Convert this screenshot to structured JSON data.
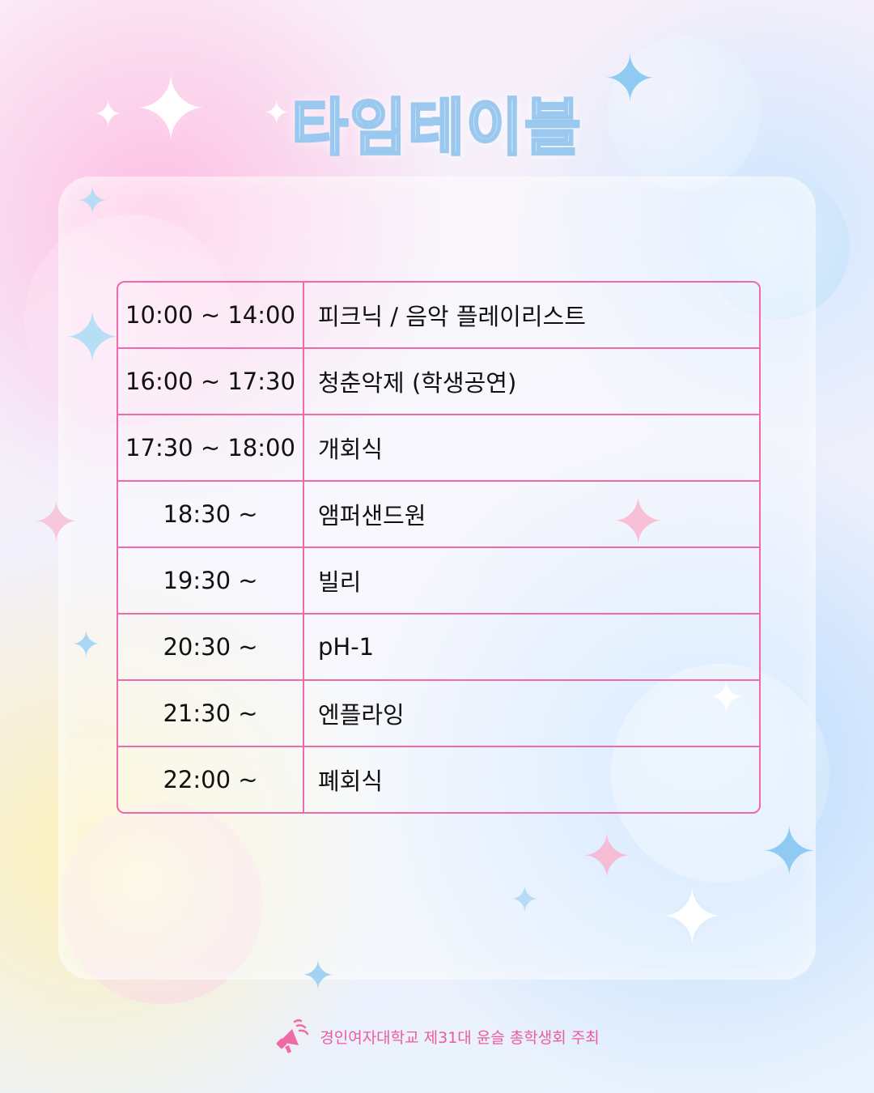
{
  "title": "타임테이블",
  "schedule": [
    {
      "time": "10:00 ~ 14:00",
      "event": "피크닉 / 음악 플레이리스트"
    },
    {
      "time": "16:00 ~ 17:30",
      "event": "청춘악제 (학생공연)"
    },
    {
      "time": "17:30 ~ 18:00",
      "event": "개회식"
    },
    {
      "time": "18:30 ~",
      "event": "앰퍼샌드원"
    },
    {
      "time": "19:30 ~",
      "event": "빌리"
    },
    {
      "time": "20:30 ~",
      "event": "pH-1"
    },
    {
      "time": "21:30 ~",
      "event": "엔플라잉"
    },
    {
      "time": "22:00 ~",
      "event": "폐회식"
    }
  ],
  "footer": {
    "text": "경인여자대학교 제31대 윤슬 총학생회 주최",
    "icon": "megaphone-icon"
  },
  "colors": {
    "accent_pink": "#ee6aaa",
    "title_outline": "#9ac8ee",
    "footer_text": "#ee5aa0"
  }
}
